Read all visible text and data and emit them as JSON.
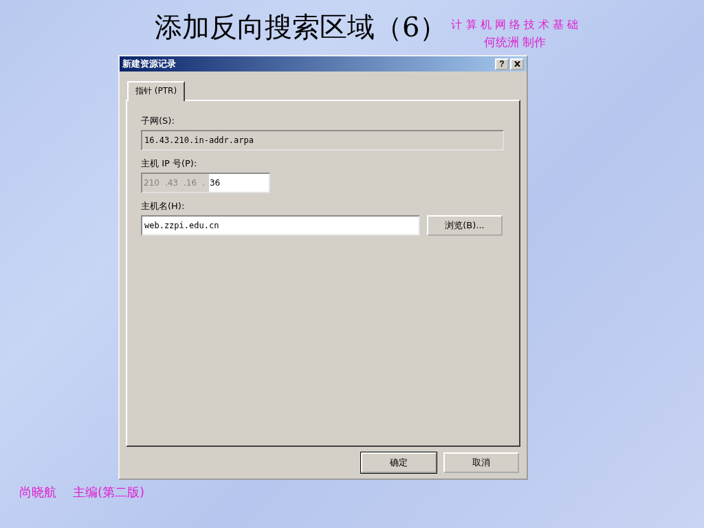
{
  "slide": {
    "title": "添加反向搜索区域（6）",
    "course": "计 算 机 网 络 技 术 基 础",
    "author": "何统洲 制作",
    "footer": [
      "尚晓航",
      "主编(第二版)"
    ]
  },
  "dialog": {
    "title": "新建资源记录",
    "help": "?",
    "tabs": [
      {
        "label": "指针 (PTR)",
        "selected": true
      }
    ],
    "fields": [
      {
        "kind": "text",
        "label": "子网(S):",
        "value": "16.43.210.in-addr.arpa",
        "disabled": true
      },
      {
        "kind": "ip",
        "label": "主机 IP 号(P):",
        "parts": [
          {
            "text": "210",
            "disabled": true
          },
          {
            "text": ".43",
            "disabled": true
          },
          {
            "text": ".16",
            "disabled": true
          },
          {
            "text": ".",
            "disabled": true
          },
          {
            "text": "36",
            "disabled": false
          }
        ]
      },
      {
        "kind": "text",
        "label": "主机名(H):",
        "value": "web.zzpi.edu.cn",
        "disabled": false,
        "button": "浏览(B)..."
      }
    ],
    "buttons": [
      {
        "label": "确定",
        "default": true
      },
      {
        "label": "取消",
        "default": false
      }
    ]
  }
}
